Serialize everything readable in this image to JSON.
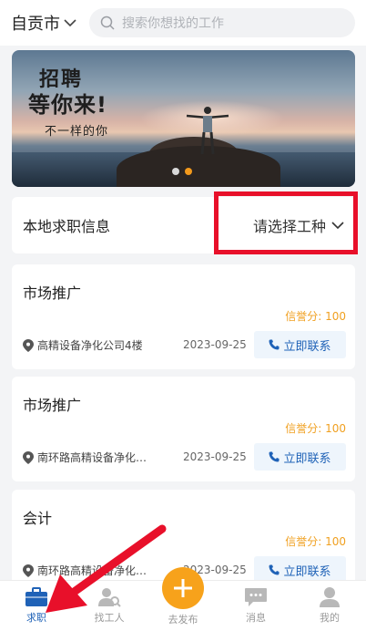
{
  "topbar": {
    "city": "自贡市",
    "search_placeholder": "搜索你想找的工作"
  },
  "banner": {
    "headline_1": "招聘",
    "headline_2": "等你来!",
    "tagline": "不一样的你",
    "slide_count": 2,
    "active_slide": 2
  },
  "filter": {
    "label": "本地求职信息",
    "select_label": "请选择工种"
  },
  "jobs": [
    {
      "title": "市场推广",
      "credit": "信誉分: 100",
      "location": "高精设备净化公司4楼",
      "date": "2023-09-25",
      "contact": "立即联系"
    },
    {
      "title": "市场推广",
      "credit": "信誉分: 100",
      "location": "南环路高精设备净化…",
      "date": "2023-09-25",
      "contact": "立即联系"
    },
    {
      "title": "会计",
      "credit": "信誉分: 100",
      "location": "南环路高精设备净化…",
      "date": "2023-09-25",
      "contact": "立即联系"
    }
  ],
  "tabs": [
    {
      "label": "求职",
      "icon": "briefcase-icon",
      "active": true
    },
    {
      "label": "找工人",
      "icon": "find-worker-icon",
      "active": false
    },
    {
      "label": "去发布",
      "icon": "plus-icon",
      "active": false
    },
    {
      "label": "消息",
      "icon": "message-icon",
      "active": false
    },
    {
      "label": "我的",
      "icon": "user-icon",
      "active": false
    }
  ],
  "colors": {
    "accent_blue": "#1f62b7",
    "accent_orange": "#f7a21b",
    "highlight_red": "#e8102a"
  }
}
